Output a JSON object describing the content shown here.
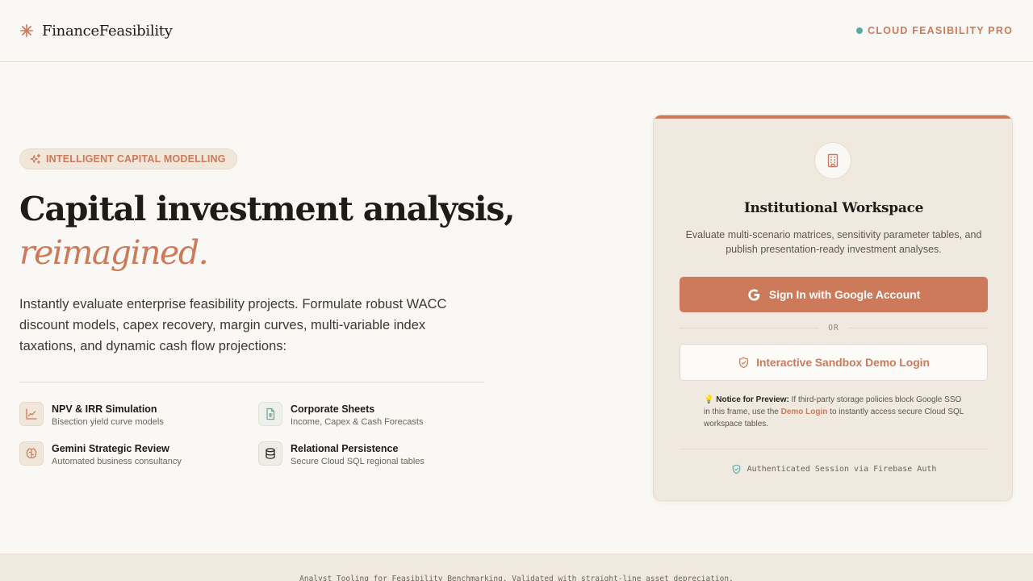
{
  "brand": {
    "name": "FinanceFeasibility",
    "icon": "asterisk-icon",
    "accent": "#cd7a5a"
  },
  "status": {
    "label": "CLOUD FEASIBILITY PRO",
    "dot_color": "#5aa8a6"
  },
  "hero": {
    "pill": "INTELLIGENT CAPITAL MODELLING",
    "title": "Capital investment analysis,",
    "accent": "reimagined.",
    "description": "Instantly evaluate enterprise feasibility projects. Formulate robust WACC discount models, capex recovery, margin curves, multi-variable index taxations, and dynamic cash flow projections:"
  },
  "features": [
    {
      "icon": "line-chart-icon",
      "title": "NPV & IRR Simulation",
      "subtitle": "Bisection yield curve models"
    },
    {
      "icon": "spreadsheet-icon",
      "title": "Corporate Sheets",
      "subtitle": "Income, Capex & Cash Forecasts"
    },
    {
      "icon": "brain-icon",
      "title": "Gemini Strategic Review",
      "subtitle": "Automated business consultancy"
    },
    {
      "icon": "database-icon",
      "title": "Relational Persistence",
      "subtitle": "Secure Cloud SQL regional tables"
    }
  ],
  "card": {
    "icon": "building-icon",
    "title": "Institutional Workspace",
    "description": "Evaluate multi-scenario matrices, sensitivity parameter tables, and publish presentation-ready investment analyses.",
    "google_button": "Sign In with Google Account",
    "or": "OR",
    "demo_button": "Interactive Sandbox Demo Login",
    "notice": {
      "emoji": "💡",
      "label": "Notice for Preview:",
      "text_before": " If third-party storage policies block Google SSO in this frame, use the ",
      "link": "Demo Login",
      "text_after": " to instantly access secure Cloud SQL workspace tables."
    },
    "auth": "Authenticated Session via Firebase Auth"
  },
  "footer": {
    "text": "Analyst Tooling for Feasibility Benchmarking. Validated with straight-line asset depreciation."
  }
}
